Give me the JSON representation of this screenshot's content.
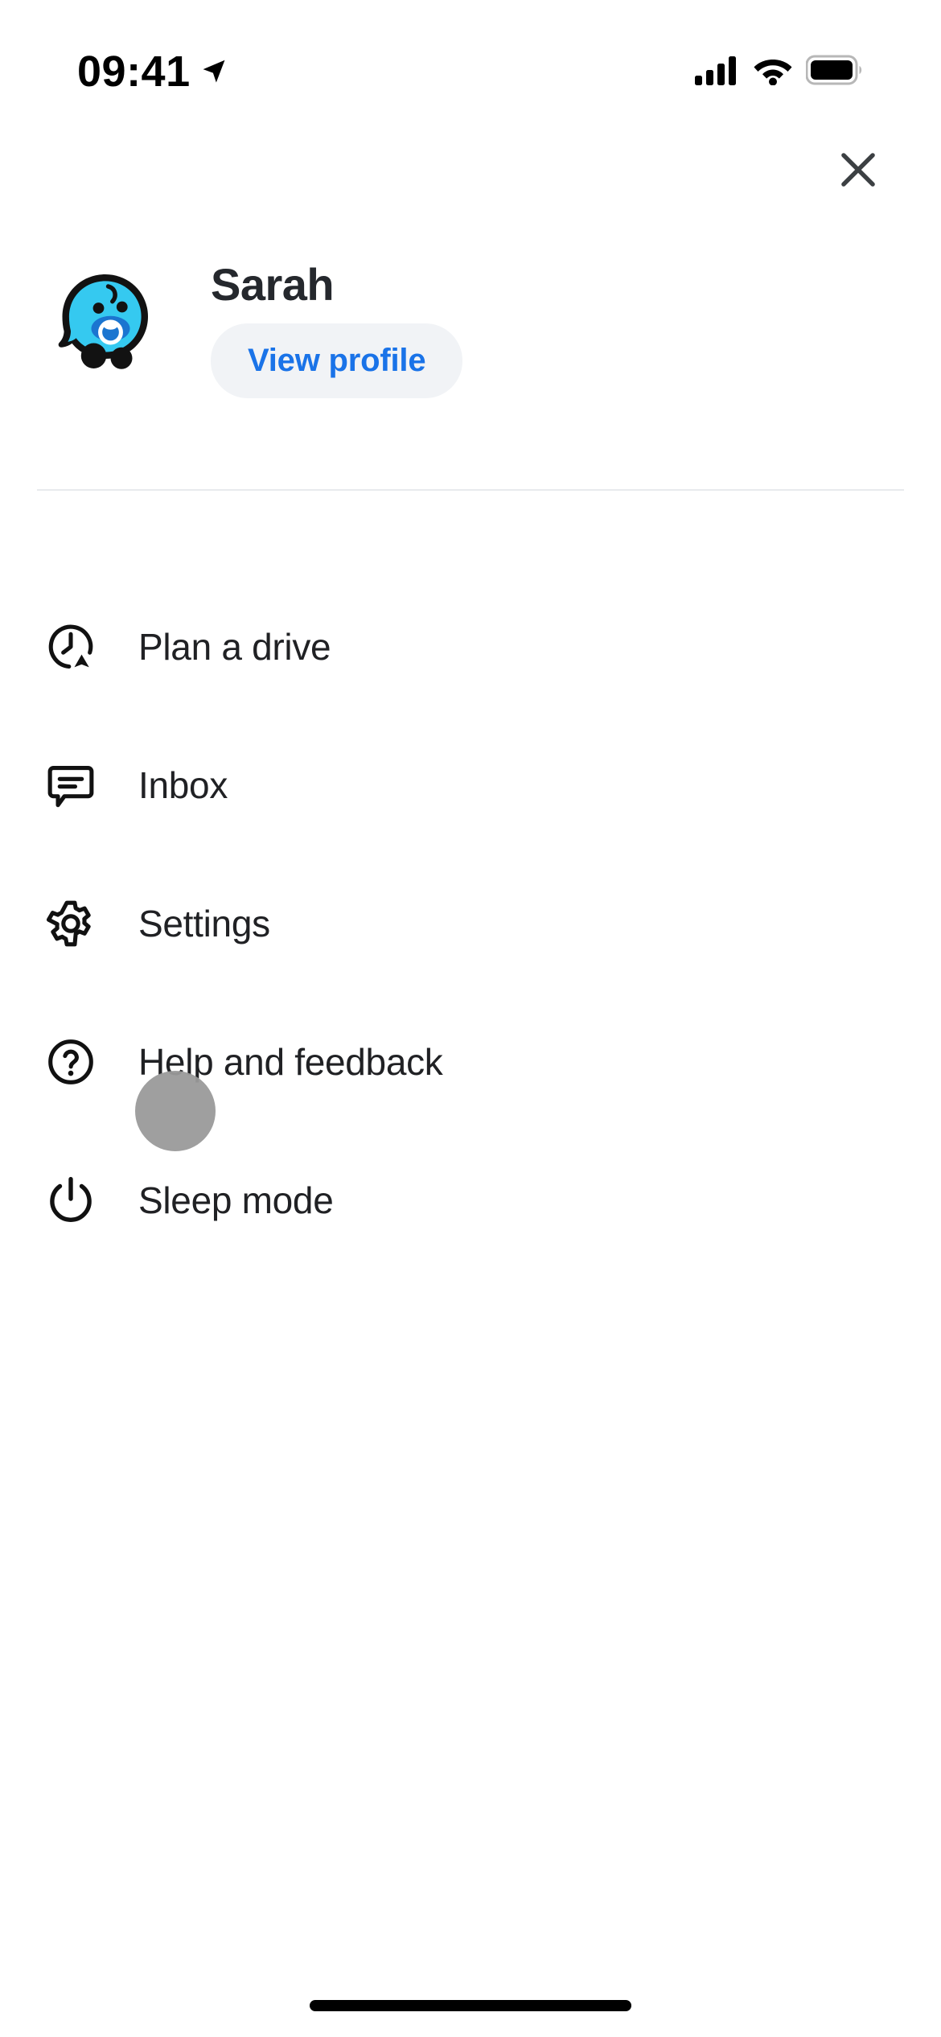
{
  "status_bar": {
    "time": "09:41",
    "location_icon": "location-arrow-icon",
    "cellular_icon": "cellular-bars-icon",
    "wifi_icon": "wifi-icon",
    "battery_icon": "battery-full-icon"
  },
  "header": {
    "close_icon": "close-x-icon"
  },
  "profile": {
    "avatar_icon": "waze-baby-mood-avatar",
    "name": "Sarah",
    "view_profile_label": "View profile"
  },
  "menu": {
    "items": [
      {
        "label": "Plan a drive",
        "icon": "clock-navigation-arrow-icon"
      },
      {
        "label": "Inbox",
        "icon": "chat-bubble-icon"
      },
      {
        "label": "Settings",
        "icon": "gear-icon"
      },
      {
        "label": "Help and feedback",
        "icon": "question-circle-icon"
      },
      {
        "label": "Sleep mode",
        "icon": "power-icon"
      }
    ]
  },
  "overlay": {
    "touch_indicator": "tap-indicator-dot"
  },
  "colors": {
    "accent_blue": "#1a73e8",
    "pill_background": "#f1f3f6",
    "text_primary": "#202124",
    "avatar_cyan": "#35c9f0",
    "avatar_blue": "#1b75d0",
    "divider": "#e8eaed",
    "touch_dot": "#9a9a9a"
  }
}
